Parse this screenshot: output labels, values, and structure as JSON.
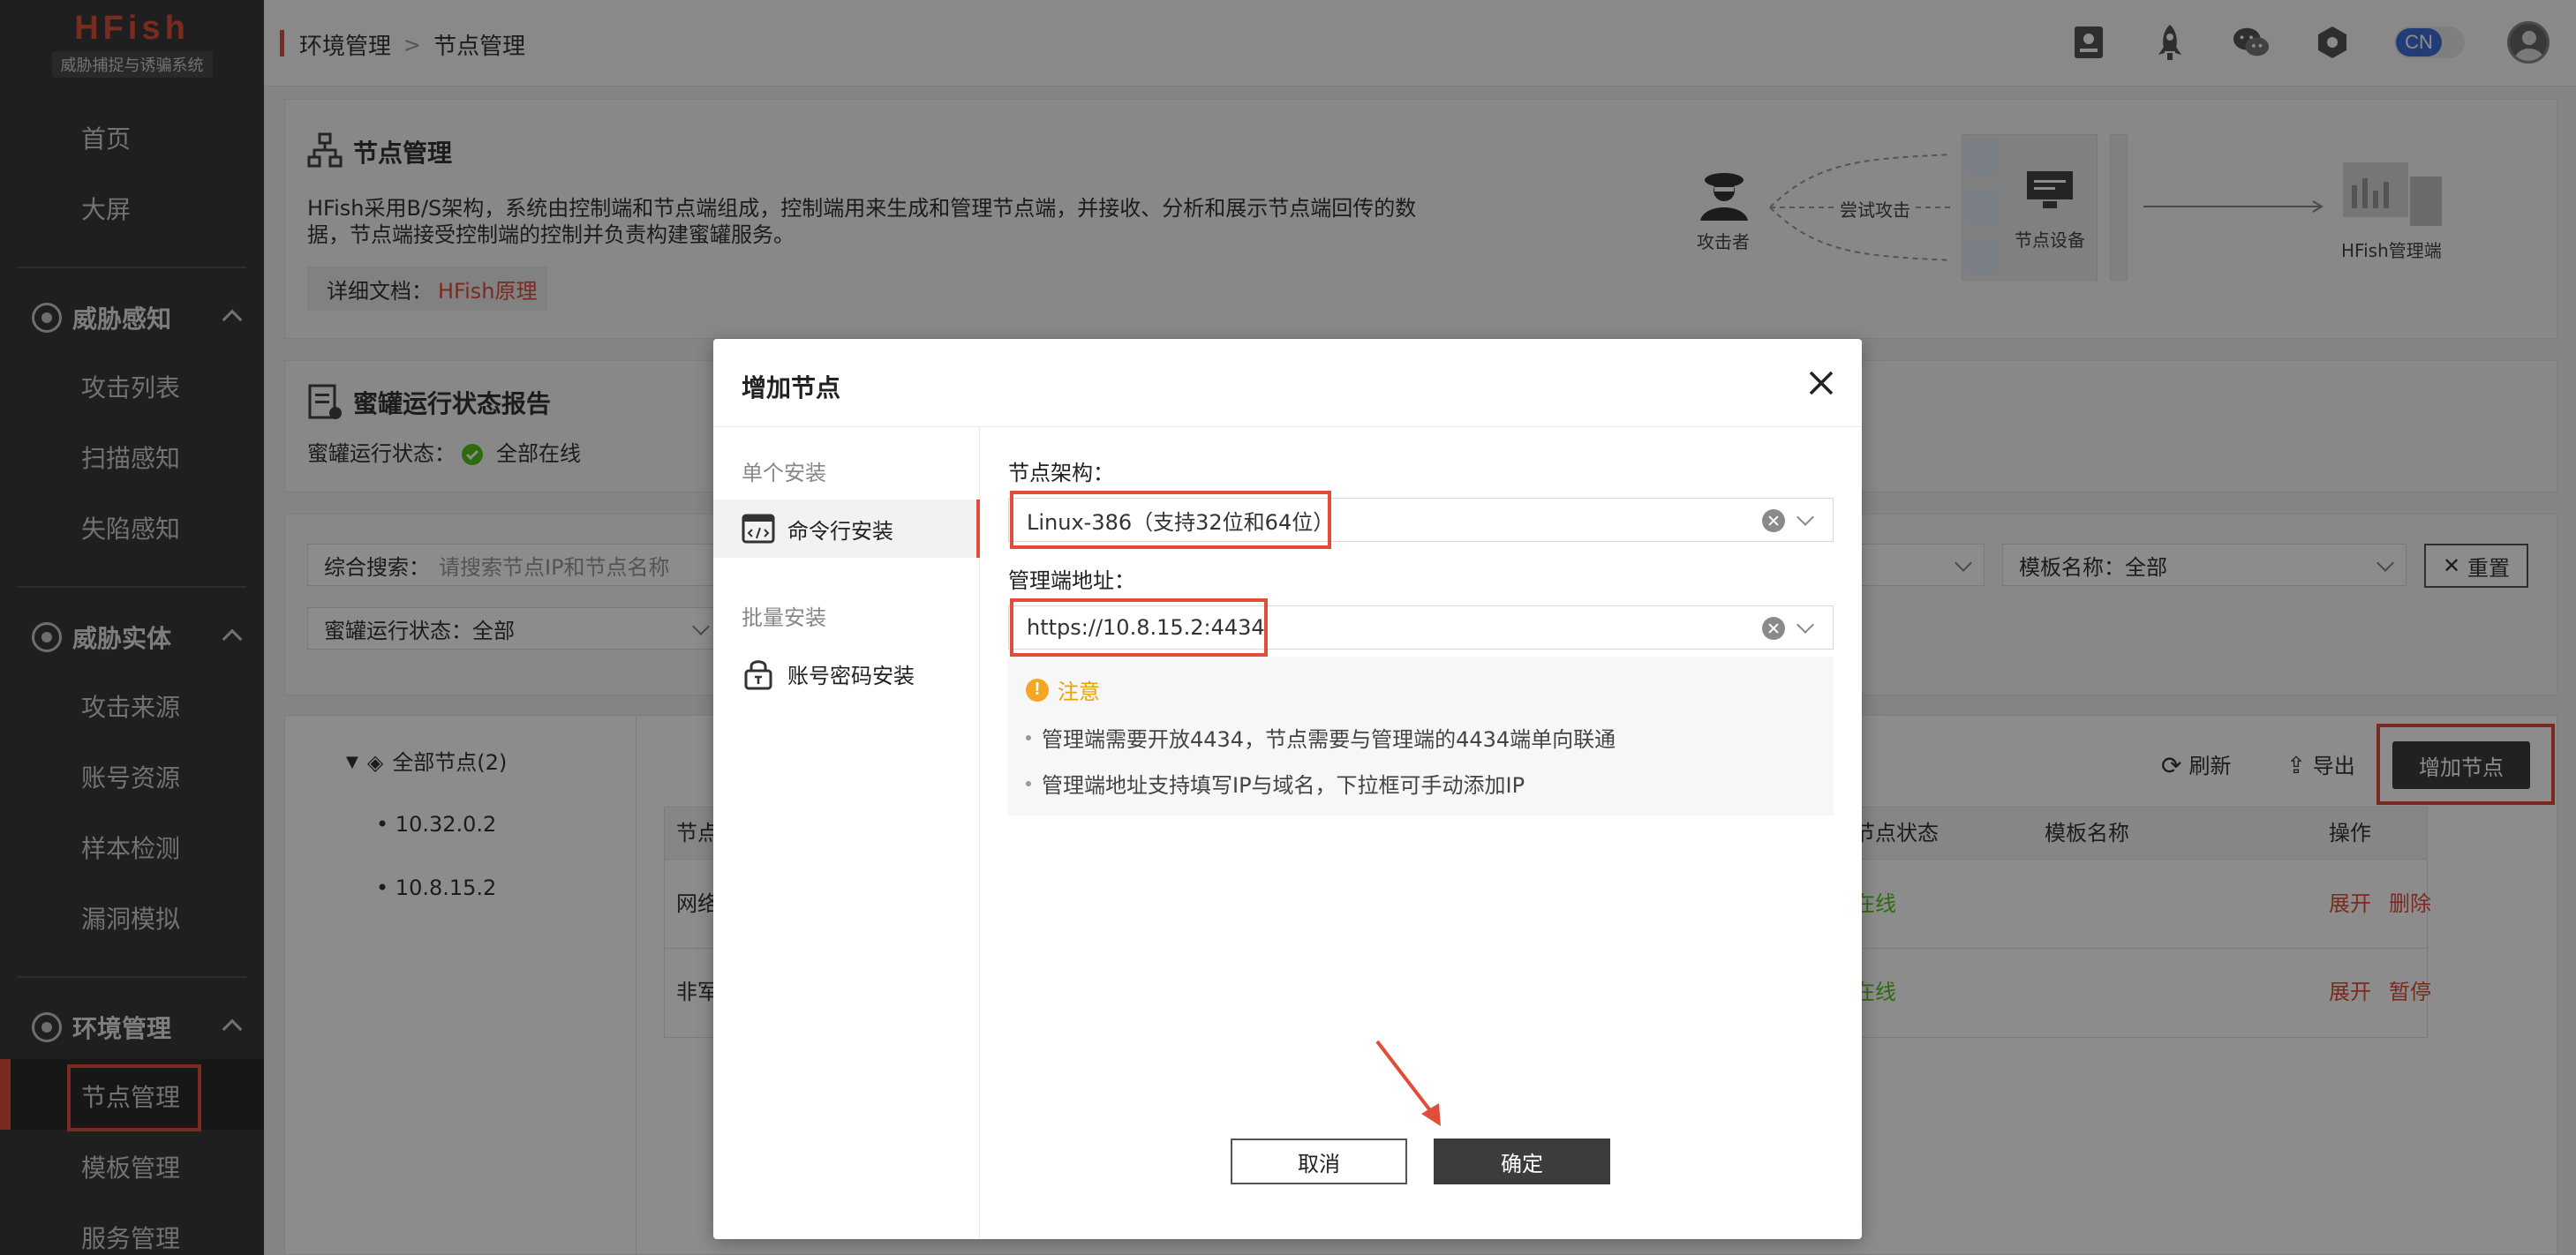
{
  "app": {
    "logo_title": "HFish",
    "logo_subtitle": "威胁捕捉与诱骗系统"
  },
  "sidebar": {
    "home": "首页",
    "bigscreen": "大屏",
    "groups": [
      {
        "label": "威胁感知",
        "items": [
          "攻击列表",
          "扫描感知",
          "失陷感知"
        ]
      },
      {
        "label": "威胁实体",
        "items": [
          "攻击来源",
          "账号资源",
          "样本检测",
          "漏洞模拟"
        ]
      },
      {
        "label": "环境管理",
        "items": [
          "节点管理",
          "模板管理",
          "服务管理"
        ]
      }
    ]
  },
  "breadcrumb": {
    "parent": "环境管理",
    "separator": ">",
    "current": "节点管理"
  },
  "topbar": {
    "lang": "CN"
  },
  "intro": {
    "title": "节点管理",
    "line1": "HFish采用B/S架构，系统由控制端和节点端组成，控制端用来生成和管理节点端，并接收、分析和展示节点端回传的数",
    "line2": "据，节点端接受控制端的控制并负责构建蜜罐服务。",
    "doc_label": "详细文档：",
    "doc_link": "HFish原理",
    "diagram": {
      "attacker": "攻击者",
      "attempt": "尝试攻击",
      "node_device": "节点设备",
      "manager": "HFish管理端"
    }
  },
  "report": {
    "title": "蜜罐运行状态报告",
    "status_label": "蜜罐运行状态：",
    "status_value": "全部在线"
  },
  "filters": {
    "search_label": "综合搜索：",
    "search_placeholder": "请搜索节点IP和节点名称",
    "template_label": "模板名称：",
    "template_value": "全部",
    "reset": "重置",
    "status_label": "蜜罐运行状态：",
    "status_value": "全部"
  },
  "tree": {
    "root": "全部节点(2)",
    "nodes": [
      "10.32.0.2",
      "10.8.15.2"
    ]
  },
  "toolbar": {
    "refresh": "刷新",
    "export": "导出",
    "add_node": "增加节点"
  },
  "table": {
    "headers": [
      "节点",
      "节点状态",
      "模板名称",
      "操作"
    ],
    "rows": [
      {
        "name_partial": "网络",
        "status_partial": "在线",
        "action1": "展开",
        "action2": "删除"
      },
      {
        "name_partial": "非军",
        "status_partial": "在线",
        "action1": "展开",
        "action2": "暂停"
      }
    ]
  },
  "modal": {
    "title": "增加节点",
    "single_install": "单个安装",
    "cmd_install": "命令行安装",
    "batch_install": "批量安装",
    "account_install": "账号密码安装",
    "arch_label": "节点架构：",
    "arch_value": "Linux-386（支持32位和64位）",
    "addr_label": "管理端地址：",
    "addr_value": "https://10.8.15.2:4434",
    "notice_title": "注意",
    "notice_1": "管理端需要开放4434，节点需要与管理端的4434端单向联通",
    "notice_2": "管理端地址支持填写IP与域名，下拉框可手动添加IP",
    "cancel": "取消",
    "ok": "确定"
  },
  "colors": {
    "accent": "#e04e39",
    "sidebar_bg": "#3a3a3a",
    "dark_button": "#3c3c3c",
    "online": "#52c41a"
  }
}
